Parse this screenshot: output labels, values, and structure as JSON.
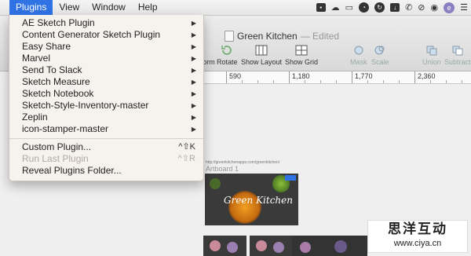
{
  "menubar": {
    "items": [
      "Plugins",
      "View",
      "Window",
      "Help"
    ],
    "active": "Plugins"
  },
  "tray": {
    "avatar_letter": "e"
  },
  "document": {
    "title": "Green Kitchen",
    "status": "— Edited"
  },
  "toolbar": {
    "buttons": [
      "orm",
      "Rotate",
      "Show Layout",
      "Show Grid",
      "Mask",
      "Scale",
      "Union",
      "Subtract"
    ]
  },
  "ruler": {
    "ticks": [
      "590",
      "1,180",
      "1,770",
      "2,360"
    ]
  },
  "plugins_menu": {
    "submenus": [
      "AE Sketch Plugin",
      "Content Generator Sketch Plugin",
      "Easy Share",
      "Marvel",
      "Send To Slack",
      "Sketch Measure",
      "Sketch Notebook",
      "Sketch-Style-Inventory-master",
      "Zeplin",
      "icon-stamper-master"
    ],
    "custom_plugin": {
      "label": "Custom Plugin...",
      "shortcut": "^⇧K"
    },
    "run_last_plugin": {
      "label": "Run Last Plugin",
      "shortcut": "^⇧R"
    },
    "reveal_folder": {
      "label": "Reveal Plugins Folder..."
    }
  },
  "artboard": {
    "url": "http://greenkitchenapps.com/greenkitchen/",
    "name": "Artboard 1",
    "hero_text": "Green Kitchen"
  },
  "watermark": {
    "title": "思洋互动",
    "url": "www.ciya.cn"
  }
}
